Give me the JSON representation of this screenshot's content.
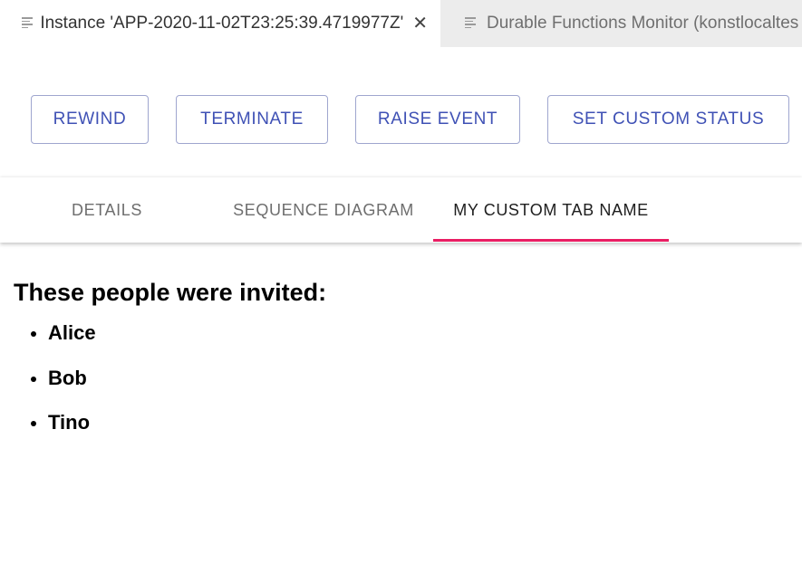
{
  "editor_tabs": [
    {
      "label": "Instance 'APP-2020-11-02T23:25:39.4719977Z'",
      "active": true,
      "closable": true,
      "icon": "lines-icon"
    },
    {
      "label": "Durable Functions Monitor (konstlocaltes",
      "active": false,
      "closable": false,
      "icon": "lines-icon"
    }
  ],
  "actions": {
    "rewind": "REWIND",
    "terminate": "TERMINATE",
    "raise_event": "RAISE EVENT",
    "set_custom_status": "SET CUSTOM STATUS"
  },
  "tabs": [
    {
      "label": "DETAILS",
      "selected": false
    },
    {
      "label": "SEQUENCE DIAGRAM",
      "selected": false
    },
    {
      "label": "MY CUSTOM TAB NAME",
      "selected": true
    }
  ],
  "content": {
    "heading": "These people were invited:",
    "people": [
      "Alice",
      "Bob",
      "Tino"
    ]
  },
  "colors": {
    "accent": "#3f51b5",
    "tab_indicator": "#e91e63",
    "button_border": "#9fa6cf"
  }
}
